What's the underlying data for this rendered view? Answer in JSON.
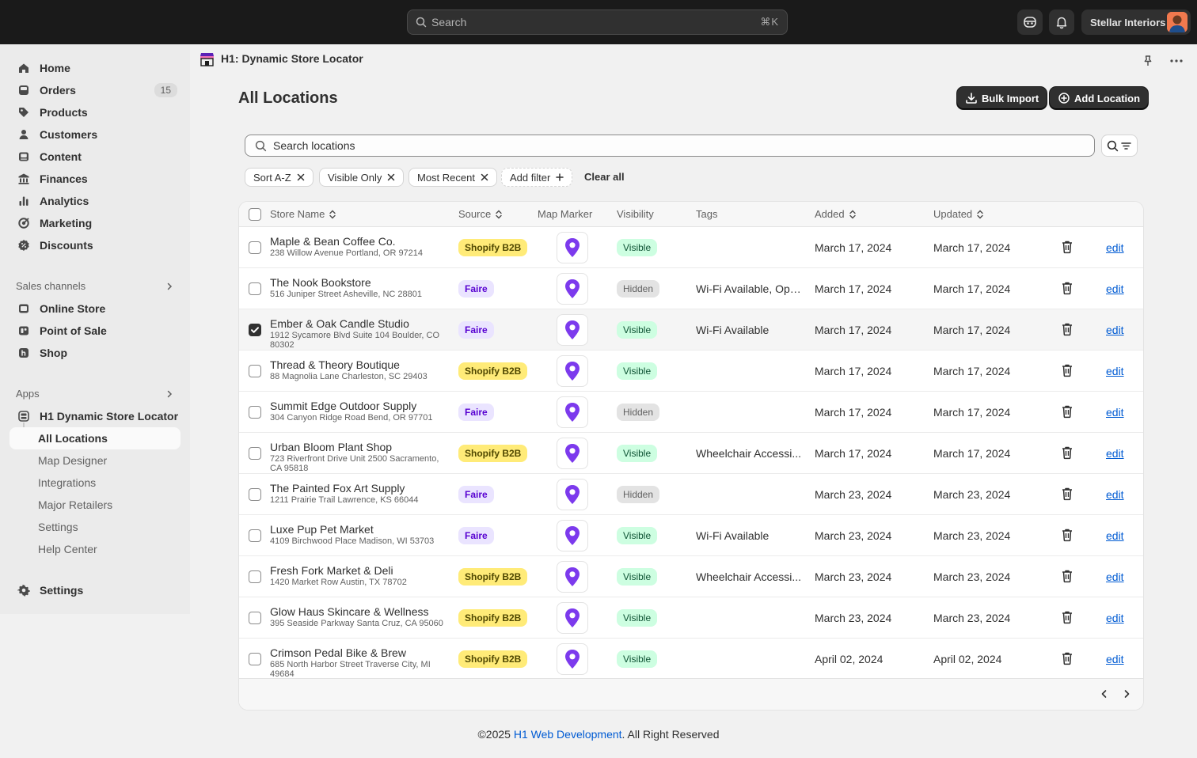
{
  "topbar": {
    "search_placeholder": "Search",
    "shortcut": "⌘K",
    "store_name": "Stellar Interiors"
  },
  "sidebar": {
    "items": [
      {
        "label": "Home",
        "icon": "home-icon"
      },
      {
        "label": "Orders",
        "icon": "orders-icon",
        "count": "15"
      },
      {
        "label": "Products",
        "icon": "tag-icon"
      },
      {
        "label": "Customers",
        "icon": "person-icon"
      },
      {
        "label": "Content",
        "icon": "content-icon"
      },
      {
        "label": "Finances",
        "icon": "bank-icon"
      },
      {
        "label": "Analytics",
        "icon": "bar-chart-icon"
      },
      {
        "label": "Marketing",
        "icon": "target-icon"
      },
      {
        "label": "Discounts",
        "icon": "discount-icon"
      }
    ],
    "sales_channels_label": "Sales channels",
    "sales_channels": [
      {
        "label": "Online Store",
        "icon": "store-icon"
      },
      {
        "label": "Point of Sale",
        "icon": "pos-icon"
      },
      {
        "label": "Shop",
        "icon": "shop-icon"
      }
    ],
    "apps_label": "Apps",
    "app_name": "H1 Dynamic Store Locator",
    "app_subitems": [
      "All Locations",
      "Map Designer",
      "Integrations",
      "Major Retailers",
      "Settings",
      "Help Center"
    ],
    "settings_label": "Settings"
  },
  "page": {
    "app_header": "H1: Dynamic Store Locator",
    "title": "All Locations",
    "bulk_import": "Bulk Import",
    "add_location": "Add Location",
    "search_placeholder": "Search locations",
    "filters": [
      "Sort A-Z",
      "Visible Only",
      "Most Recent"
    ],
    "add_filter": "Add filter",
    "clear_all": "Clear all"
  },
  "table": {
    "headers": {
      "store_name": "Store Name",
      "source": "Source",
      "map_marker": "Map Marker",
      "visibility": "Visibility",
      "tags": "Tags",
      "added": "Added",
      "updated": "Updated"
    },
    "edit_label": "edit",
    "rows": [
      {
        "name": "Maple & Bean Coffee Co.",
        "address": "238 Willow Avenue Portland, OR 97214",
        "source": "Shopify B2B",
        "visibility": "Visible",
        "tags": "",
        "added": "March 17, 2024",
        "updated": "March 17, 2024",
        "checked": false
      },
      {
        "name": "The Nook Bookstore",
        "address": "516 Juniper Street Asheville, NC 28801",
        "source": "Faire",
        "visibility": "Hidden",
        "tags": "Wi-Fi Available, Ope...",
        "added": "March 17, 2024",
        "updated": "March 17, 2024",
        "checked": false
      },
      {
        "name": "Ember & Oak Candle Studio",
        "address": "1912 Sycamore Blvd Suite 104 Boulder, CO 80302",
        "source": "Faire",
        "visibility": "Visible",
        "tags": "Wi-Fi Available",
        "added": "March 17, 2024",
        "updated": "March 17, 2024",
        "checked": true
      },
      {
        "name": "Thread & Theory Boutique",
        "address": "88 Magnolia Lane Charleston, SC 29403",
        "source": "Shopify B2B",
        "visibility": "Visible",
        "tags": "",
        "added": "March 17, 2024",
        "updated": "March 17, 2024",
        "checked": false
      },
      {
        "name": "Summit Edge Outdoor Supply",
        "address": "304 Canyon Ridge Road Bend, OR 97701",
        "source": "Faire",
        "visibility": "Hidden",
        "tags": "",
        "added": "March 17, 2024",
        "updated": "March 17, 2024",
        "checked": false
      },
      {
        "name": "Urban Bloom Plant Shop",
        "address": "723 Riverfront Drive Unit 2500 Sacramento, CA 95818",
        "source": "Shopify B2B",
        "visibility": "Visible",
        "tags": "Wheelchair Accessi...",
        "added": "March 17, 2024",
        "updated": "March 17, 2024",
        "checked": false
      },
      {
        "name": "The Painted Fox Art Supply",
        "address": "1211 Prairie Trail Lawrence, KS 66044",
        "source": "Faire",
        "visibility": "Hidden",
        "tags": "",
        "added": "March 23, 2024",
        "updated": "March 23, 2024",
        "checked": false
      },
      {
        "name": "Luxe Pup Pet Market",
        "address": "4109 Birchwood Place Madison, WI 53703",
        "source": "Faire",
        "visibility": "Visible",
        "tags": "Wi-Fi Available",
        "added": "March 23, 2024",
        "updated": "March 23, 2024",
        "checked": false
      },
      {
        "name": "Fresh Fork Market & Deli",
        "address": "1420 Market Row Austin, TX 78702",
        "source": "Shopify B2B",
        "visibility": "Visible",
        "tags": "Wheelchair Accessi...",
        "added": "March 23, 2024",
        "updated": "March 23, 2024",
        "checked": false
      },
      {
        "name": "Glow Haus Skincare & Wellness",
        "address": "395 Seaside Parkway Santa Cruz, CA 95060",
        "source": "Shopify B2B",
        "visibility": "Visible",
        "tags": "",
        "added": "March 23, 2024",
        "updated": "March 23, 2024",
        "checked": false
      },
      {
        "name": "Crimson Pedal Bike & Brew",
        "address": "685 North Harbor Street Traverse City, MI 49684",
        "source": "Shopify B2B",
        "visibility": "Visible",
        "tags": "",
        "added": "April 02, 2024",
        "updated": "April 02, 2024",
        "checked": false
      }
    ]
  },
  "footer": {
    "prefix": "©2025 ",
    "link": "H1 Web Development",
    "suffix": ". All Right Reserved"
  },
  "colors": {
    "marker": "#7c3aed",
    "link": "#005bd3"
  }
}
